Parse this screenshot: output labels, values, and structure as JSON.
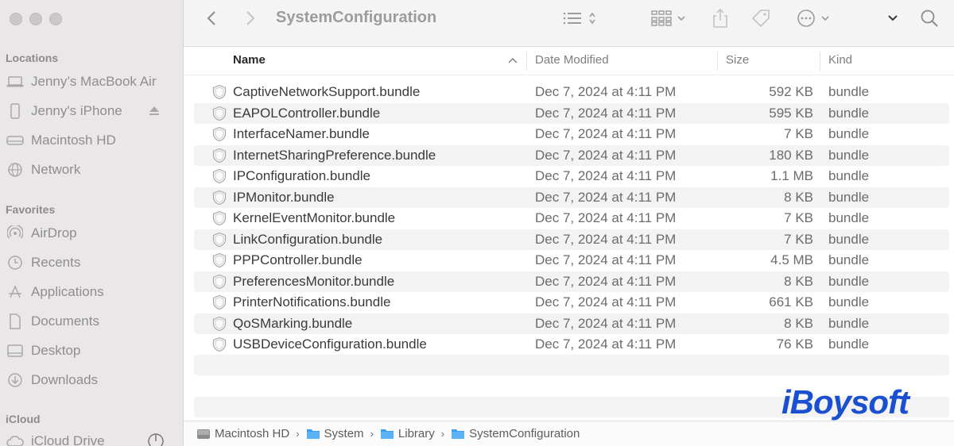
{
  "window": {
    "title": "SystemConfiguration"
  },
  "sidebar": {
    "locations_title": "Locations",
    "locations": [
      {
        "label": "Jenny’s MacBook Air",
        "icon": "laptop-icon"
      },
      {
        "label": "Jenny's iPhone",
        "icon": "iphone-icon"
      },
      {
        "label": "Macintosh HD",
        "icon": "drive-icon"
      },
      {
        "label": "Network",
        "icon": "globe-icon"
      }
    ],
    "favorites_title": "Favorites",
    "favorites": [
      {
        "label": "AirDrop",
        "icon": "airdrop-icon"
      },
      {
        "label": "Recents",
        "icon": "clock-icon"
      },
      {
        "label": "Applications",
        "icon": "applications-icon"
      },
      {
        "label": "Documents",
        "icon": "document-icon"
      },
      {
        "label": "Desktop",
        "icon": "desktop-icon"
      },
      {
        "label": "Downloads",
        "icon": "download-icon"
      }
    ],
    "icloud_title": "iCloud",
    "icloud": [
      {
        "label": "iCloud Drive",
        "icon": "cloud-icon"
      }
    ]
  },
  "columns": {
    "name": "Name",
    "date": "Date Modified",
    "size": "Size",
    "kind": "Kind"
  },
  "files": [
    {
      "name": "CaptiveNetworkSupport.bundle",
      "date": "Dec 7, 2024 at 4:11 PM",
      "size": "592 KB",
      "kind": "bundle"
    },
    {
      "name": "EAPOLController.bundle",
      "date": "Dec 7, 2024 at 4:11 PM",
      "size": "595 KB",
      "kind": "bundle"
    },
    {
      "name": "InterfaceNamer.bundle",
      "date": "Dec 7, 2024 at 4:11 PM",
      "size": "7 KB",
      "kind": "bundle"
    },
    {
      "name": "InternetSharingPreference.bundle",
      "date": "Dec 7, 2024 at 4:11 PM",
      "size": "180 KB",
      "kind": "bundle"
    },
    {
      "name": "IPConfiguration.bundle",
      "date": "Dec 7, 2024 at 4:11 PM",
      "size": "1.1 MB",
      "kind": "bundle"
    },
    {
      "name": "IPMonitor.bundle",
      "date": "Dec 7, 2024 at 4:11 PM",
      "size": "8 KB",
      "kind": "bundle"
    },
    {
      "name": "KernelEventMonitor.bundle",
      "date": "Dec 7, 2024 at 4:11 PM",
      "size": "7 KB",
      "kind": "bundle"
    },
    {
      "name": "LinkConfiguration.bundle",
      "date": "Dec 7, 2024 at 4:11 PM",
      "size": "7 KB",
      "kind": "bundle"
    },
    {
      "name": "PPPController.bundle",
      "date": "Dec 7, 2024 at 4:11 PM",
      "size": "4.5 MB",
      "kind": "bundle"
    },
    {
      "name": "PreferencesMonitor.bundle",
      "date": "Dec 7, 2024 at 4:11 PM",
      "size": "8 KB",
      "kind": "bundle"
    },
    {
      "name": "PrinterNotifications.bundle",
      "date": "Dec 7, 2024 at 4:11 PM",
      "size": "661 KB",
      "kind": "bundle"
    },
    {
      "name": "QoSMarking.bundle",
      "date": "Dec 7, 2024 at 4:11 PM",
      "size": "8 KB",
      "kind": "bundle"
    },
    {
      "name": "USBDeviceConfiguration.bundle",
      "date": "Dec 7, 2024 at 4:11 PM",
      "size": "76 KB",
      "kind": "bundle"
    }
  ],
  "pathbar": [
    {
      "label": "Macintosh HD",
      "icon": "drive-icon"
    },
    {
      "label": "System",
      "icon": "folder-icon"
    },
    {
      "label": "Library",
      "icon": "folder-icon"
    },
    {
      "label": "SystemConfiguration",
      "icon": "folder-icon"
    }
  ],
  "watermark": {
    "text": "iBoysoft",
    "color": "#1a4fcf"
  }
}
